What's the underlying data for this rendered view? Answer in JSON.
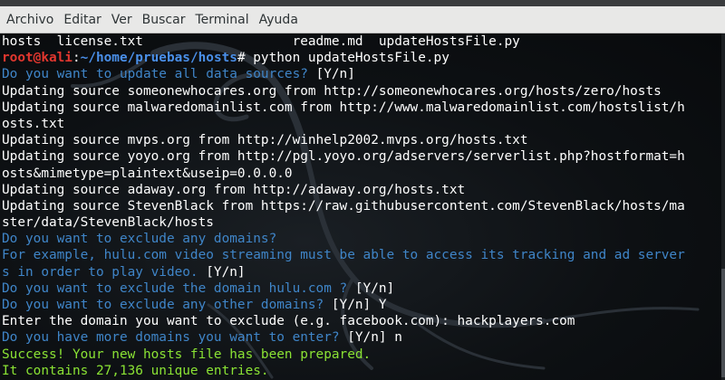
{
  "menu": {
    "items": [
      "Archivo",
      "Editar",
      "Ver",
      "Buscar",
      "Terminal",
      "Ayuda"
    ]
  },
  "terminal": {
    "colors": {
      "prompt_user": "#e2372f",
      "prompt_path": "#4a8fe8",
      "question": "#3f85c8",
      "success": "#8ae234",
      "text": "#ffffff",
      "background": "#0d1013"
    },
    "lines": [
      [
        {
          "t": "hosts  license.txt                   readme.md  updateHostsFile.py",
          "c": "white"
        }
      ],
      [
        {
          "t": "root@kali",
          "c": "prompt-user"
        },
        {
          "t": ":",
          "c": "white"
        },
        {
          "t": "~/home/pruebas/hosts",
          "c": "prompt-path"
        },
        {
          "t": "# python updateHostsFile.py",
          "c": "white"
        }
      ],
      [
        {
          "t": "Do you want to update all data sources? ",
          "c": "blue"
        },
        {
          "t": "[Y/n]",
          "c": "white"
        }
      ],
      [
        {
          "t": "Updating source someonewhocares.org from http://someonewhocares.org/hosts/zero/hosts",
          "c": "white"
        }
      ],
      [
        {
          "t": "Updating source malwaredomainlist.com from http://www.malwaredomainlist.com/hostslist/h",
          "c": "white"
        }
      ],
      [
        {
          "t": "osts.txt",
          "c": "white"
        }
      ],
      [
        {
          "t": "Updating source mvps.org from http://winhelp2002.mvps.org/hosts.txt",
          "c": "white"
        }
      ],
      [
        {
          "t": "Updating source yoyo.org from http://pgl.yoyo.org/adservers/serverlist.php?hostformat=h",
          "c": "white"
        }
      ],
      [
        {
          "t": "osts&mimetype=plaintext&useip=0.0.0.0",
          "c": "white"
        }
      ],
      [
        {
          "t": "Updating source adaway.org from http://adaway.org/hosts.txt",
          "c": "white"
        }
      ],
      [
        {
          "t": "Updating source StevenBlack from https://raw.githubusercontent.com/StevenBlack/hosts/ma",
          "c": "white"
        }
      ],
      [
        {
          "t": "ster/data/StevenBlack/hosts",
          "c": "white"
        }
      ],
      [
        {
          "t": "Do you want to exclude any domains?",
          "c": "blue"
        }
      ],
      [
        {
          "t": "For example, hulu.com video streaming must be able to access its tracking and ad server",
          "c": "blue"
        }
      ],
      [
        {
          "t": "s in order to play video. ",
          "c": "blue"
        },
        {
          "t": "[Y/n]",
          "c": "white"
        }
      ],
      [
        {
          "t": "Do you want to exclude the domain hulu.com ? ",
          "c": "blue"
        },
        {
          "t": "[Y/n]",
          "c": "white"
        }
      ],
      [
        {
          "t": "Do you want to exclude any other domains? ",
          "c": "blue"
        },
        {
          "t": "[Y/n] Y",
          "c": "white"
        }
      ],
      [
        {
          "t": "Enter the domain you want to exclude (e.g. facebook.com): hackplayers.com",
          "c": "white"
        }
      ],
      [
        {
          "t": "Do you have more domains you want to enter? ",
          "c": "blue"
        },
        {
          "t": "[Y/n] n",
          "c": "white"
        }
      ],
      [
        {
          "t": "Success! Your new hosts file has been prepared.",
          "c": "green"
        }
      ],
      [
        {
          "t": "It contains 27,136 unique entries.",
          "c": "green"
        }
      ]
    ]
  }
}
